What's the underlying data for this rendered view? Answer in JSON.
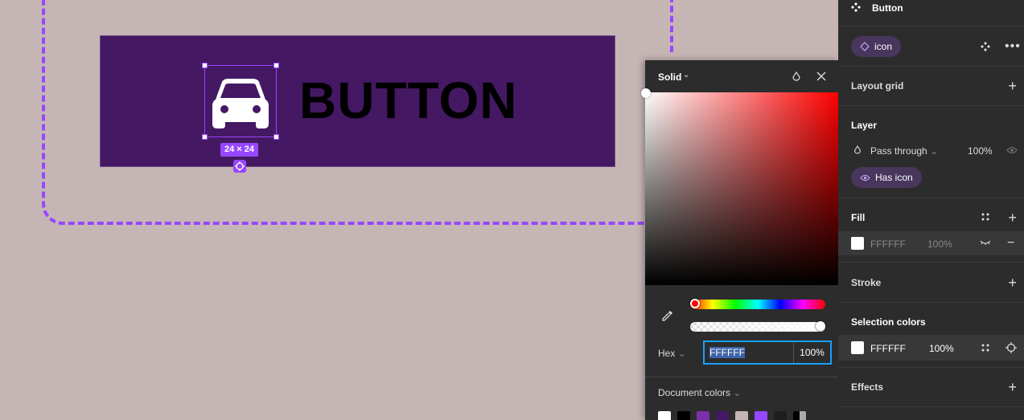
{
  "canvas": {
    "button_text": "BUTTON",
    "size_badge": "24 × 24",
    "frame_color": "#451863",
    "canvas_color": "#c6b5b5",
    "selection_color": "#9747ff"
  },
  "color_picker": {
    "type_label": "Solid",
    "hex_label": "Hex",
    "hex_value": "FFFFFF",
    "opacity": "100%",
    "document_colors_label": "Document colors",
    "document_colors": [
      "#ffffff",
      "#000000",
      "#7b2fa8",
      "#451863",
      "#c6b5b5",
      "#9747ff",
      "#1e1e1e",
      "#000000"
    ]
  },
  "panel": {
    "component_title": "Button",
    "variant_chip": "icon",
    "layout_grid": "Layout grid",
    "layer": {
      "title": "Layer",
      "blend_mode": "Pass through",
      "opacity": "100%",
      "prop_chip": "Has icon"
    },
    "fill": {
      "title": "Fill",
      "hex": "FFFFFF",
      "opacity": "100%"
    },
    "stroke": "Stroke",
    "selection_colors": {
      "title": "Selection colors",
      "hex": "FFFFFF",
      "opacity": "100%"
    },
    "effects": "Effects"
  }
}
